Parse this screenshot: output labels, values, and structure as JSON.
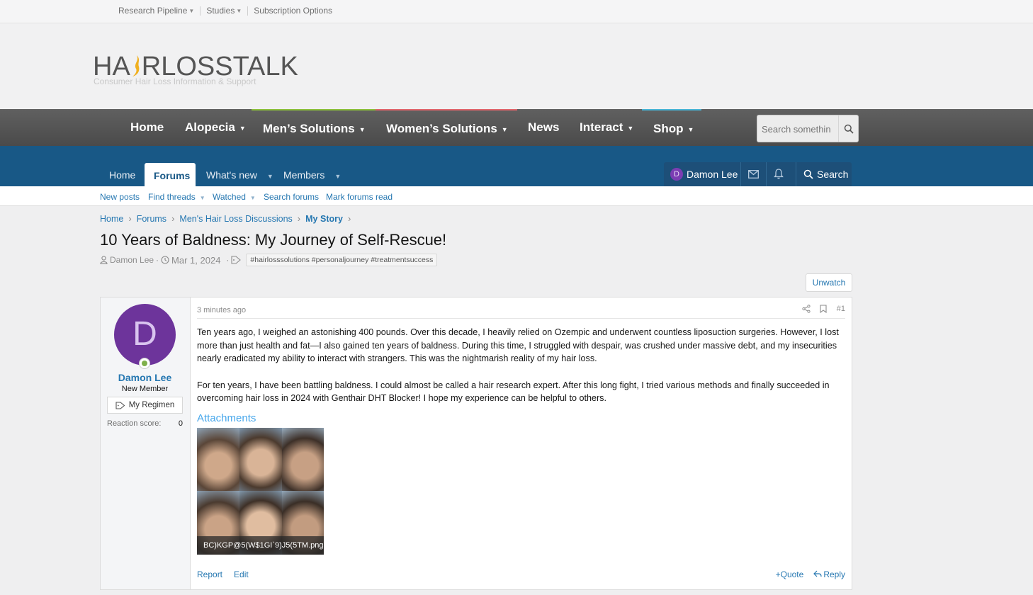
{
  "top_links": [
    {
      "label": "Research Pipeline",
      "has_caret": true
    },
    {
      "label": "Studies",
      "has_caret": true
    },
    {
      "label": "Subscription Options",
      "has_caret": false
    }
  ],
  "logo": {
    "text_left": "HA",
    "text_right": "RLOSSTALK",
    "tagline": "Consumer Hair Loss Information & Support"
  },
  "main_nav": {
    "items": [
      "Home",
      "Alopecia",
      "Men’s Solutions",
      "Women’s Solutions",
      "News",
      "Interact",
      "Shop"
    ],
    "search_placeholder": "Search somethin"
  },
  "forum_nav": {
    "home": "Home",
    "forums": "Forums",
    "whats_new": "What's new",
    "members": "Members",
    "user_initial": "D",
    "user_name": "Damon Lee",
    "search": "Search"
  },
  "sub_nav": [
    "New posts",
    "Find threads",
    "Watched",
    "Search forums",
    "Mark forums read"
  ],
  "breadcrumb": [
    "Home",
    "Forums",
    "Men's Hair Loss Discussions",
    "My Story"
  ],
  "thread": {
    "title": "10 Years of Baldness: My Journey of Self-Rescue!",
    "author": "Damon Lee",
    "date": "Mar 1, 2024",
    "tags": "#hairlosssolutions #personaljourney #treatmentsuccess",
    "unwatch": "Unwatch"
  },
  "post": {
    "avatar_initial": "D",
    "username": "Damon Lee",
    "user_title": "New Member",
    "regimen_label": "My Regimen",
    "reaction_label": "Reaction score:",
    "reaction_value": "0",
    "time": "3 minutes ago",
    "number": "#1",
    "paragraph1": "Ten years ago, I weighed an astonishing 400 pounds. Over this decade, I heavily relied on Ozempic and underwent countless liposuction surgeries. However, I lost more than just health and fat—I also gained ten years of baldness. During this time, I struggled with despair, was crushed under massive debt, and my insecurities nearly eradicated my ability to interact with strangers. This was the nightmarish reality of my hair loss.",
    "paragraph2": "For ten years, I have been battling baldness. I could almost be called a hair research expert. After this long fight, I tried various methods and finally succeeded in overcoming hair loss in 2024 with Genthair DHT Blocker! I hope my experience can be helpful to others.",
    "attachments_label": "Attachments",
    "attachment_name": "BC)KGP@5(W$1GI`9)J5(5TM.png",
    "report": "Report",
    "edit": "Edit",
    "quote": "Quote",
    "reply": "Reply"
  },
  "colors": {
    "forum_nav_bg": "#185886",
    "link": "#2577b1",
    "avatar": "#6d349b",
    "online": "#7fb04a",
    "nav_bar_mens": "#8bbf3a",
    "nav_bar_womens": "#e0646a",
    "nav_bar_shop": "#46b4d6"
  }
}
